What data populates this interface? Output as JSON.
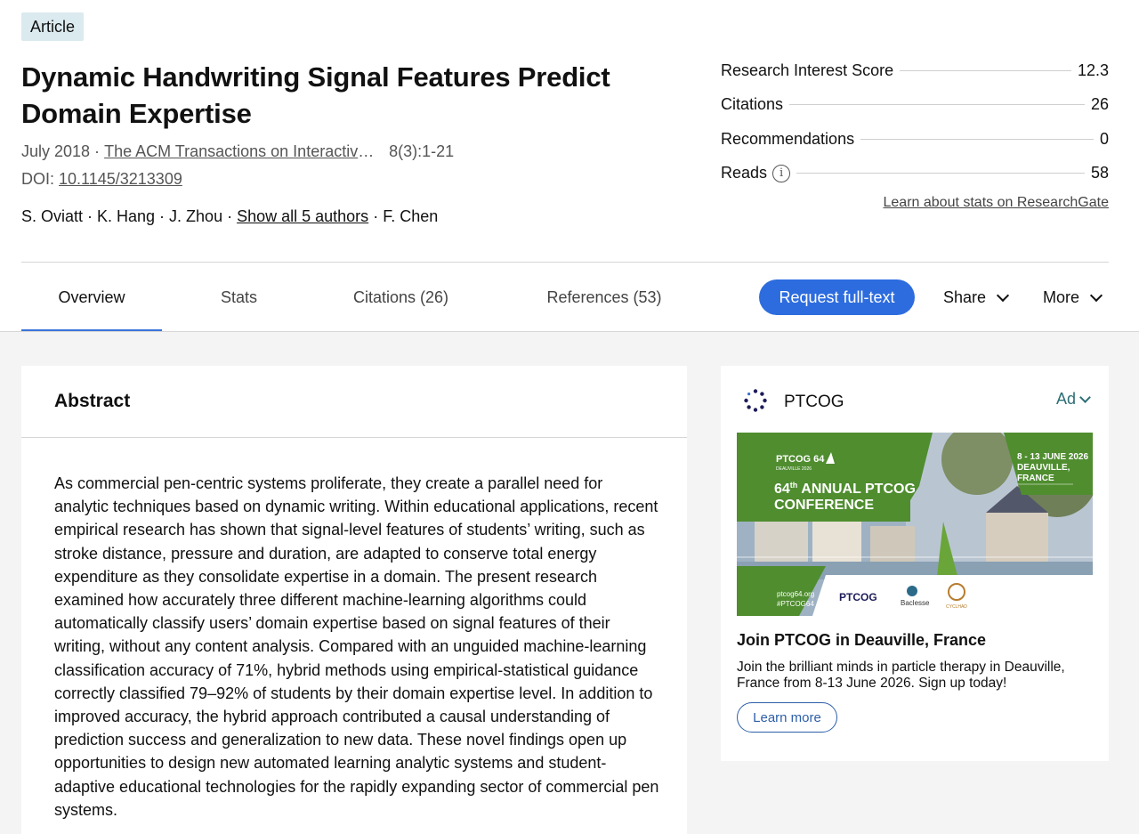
{
  "article": {
    "type_badge": "Article",
    "title": "Dynamic Handwriting Signal Features Predict Domain Expertise",
    "date": "July 2018 ·",
    "journal": "The ACM Transactions on Interactive Intelligent Systems",
    "pages": "8(3):1-21",
    "doi_label": "DOI:",
    "doi": "10.1145/3213309",
    "authors_prefix": "S. Oviatt · K. Hang · J. Zhou ·",
    "show_all_authors": "Show all 5 authors",
    "authors_suffix": "· F. Chen"
  },
  "stats": [
    {
      "label": "Research Interest Score",
      "value": "12.3"
    },
    {
      "label": "Citations",
      "value": "26"
    },
    {
      "label": "Recommendations",
      "value": "0"
    },
    {
      "label": "Reads",
      "value": "58"
    }
  ],
  "learn_stats_link": "Learn about stats on ResearchGate",
  "tabs": [
    {
      "label": "Overview",
      "active": true
    },
    {
      "label": "Stats"
    },
    {
      "label": "Citations (26)"
    },
    {
      "label": "References (53)"
    }
  ],
  "actions": {
    "request": "Request full-text",
    "share": "Share",
    "more": "More"
  },
  "abstract": {
    "heading": "Abstract",
    "text": "As commercial pen-centric systems proliferate, they create a parallel need for analytic techniques based on dynamic writing. Within educational applications, recent empirical research has shown that signal-level features of students’ writing, such as stroke distance, pressure and duration, are adapted to conserve total energy expenditure as they consolidate expertise in a domain. The present research examined how accurately three different machine-learning algorithms could automatically classify users’ domain expertise based on signal features of their writing, without any content analysis. Compared with an unguided machine-learning classification accuracy of 71%, hybrid methods using empirical-statistical guidance correctly classified 79–92% of students by their domain expertise level. In addition to improved accuracy, the hybrid approach contributed a causal understanding of prediction success and generalization to new data. These novel findings open up opportunities to design new automated learning analytic systems and student-adaptive educational technologies for the rapidly expanding sector of commercial pen systems."
  },
  "ad": {
    "brand": "PTCOG",
    "label": "Ad",
    "banner": {
      "logo_text": "PTCOG 64",
      "logo_sub": "DEAUVILLE 2026",
      "headline_num": "64",
      "headline_sup": "th",
      "headline_rest": "ANNUAL PTCOG",
      "headline_line2": "CONFERENCE",
      "dates": "8 - 13 JUNE 2026",
      "city": "DEAUVILLE,",
      "country": "FRANCE",
      "url": "ptcog64.org",
      "hashtag": "#PTCOG64",
      "sponsor1": "PTCOG",
      "sponsor2": "Baclesse",
      "sponsor3": "CYCLHAD"
    },
    "title": "Join PTCOG in Deauville, France",
    "description": "Join the brilliant minds in particle therapy in Deauville, France from 8-13 June 2026. Sign up today!",
    "cta": "Learn more"
  }
}
